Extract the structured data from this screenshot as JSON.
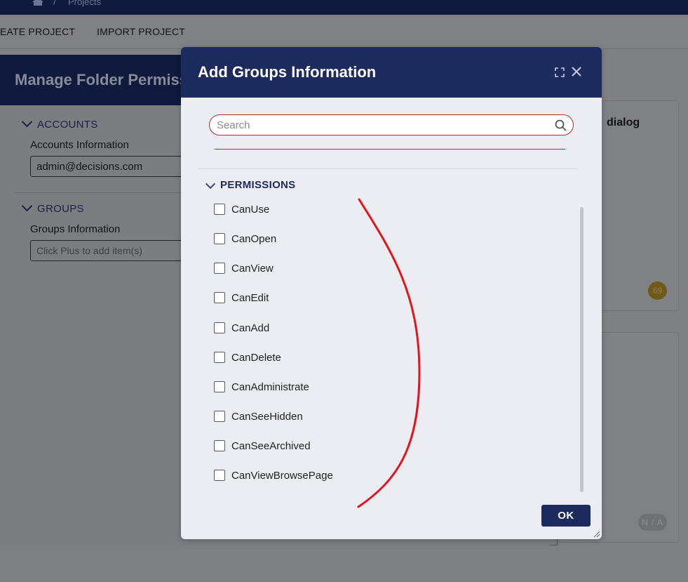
{
  "nav": {
    "home_icon": "home-icon",
    "separator": "/",
    "breadcrumb": "Projects"
  },
  "toolbar": {
    "create_label": "EATE PROJECT",
    "import_label": "IMPORT PROJECT"
  },
  "background": {
    "card_title": "dialog",
    "badge_count": "69",
    "badge_na": "N / A"
  },
  "back_dialog": {
    "title": "Manage Folder Permiss",
    "accounts_section": "ACCOUNTS",
    "accounts_label": "Accounts Information",
    "accounts_value": "admin@decisions.com",
    "groups_section": "GROUPS",
    "groups_label": "Groups Information",
    "groups_placeholder": "Click Plus to add item(s)"
  },
  "dialog": {
    "title": "Add Groups Information",
    "maximize_icon": "maximize-icon",
    "close_icon": "close-icon",
    "search_placeholder": "Search",
    "search_value": "",
    "permissions_section": "PERMISSIONS",
    "permissions": [
      {
        "label": "CanUse",
        "checked": false
      },
      {
        "label": "CanOpen",
        "checked": false
      },
      {
        "label": "CanView",
        "checked": false
      },
      {
        "label": "CanEdit",
        "checked": false
      },
      {
        "label": "CanAdd",
        "checked": false
      },
      {
        "label": "CanDelete",
        "checked": false
      },
      {
        "label": "CanAdministrate",
        "checked": false
      },
      {
        "label": "CanSeeHidden",
        "checked": false
      },
      {
        "label": "CanSeeArchived",
        "checked": false
      },
      {
        "label": "CanViewBrowsePage",
        "checked": false
      }
    ],
    "ok_label": "OK"
  },
  "colors": {
    "header_navy": "#1d2a5e",
    "annotation_red": "#e0161c",
    "dialog_bg": "#ebedf3"
  }
}
